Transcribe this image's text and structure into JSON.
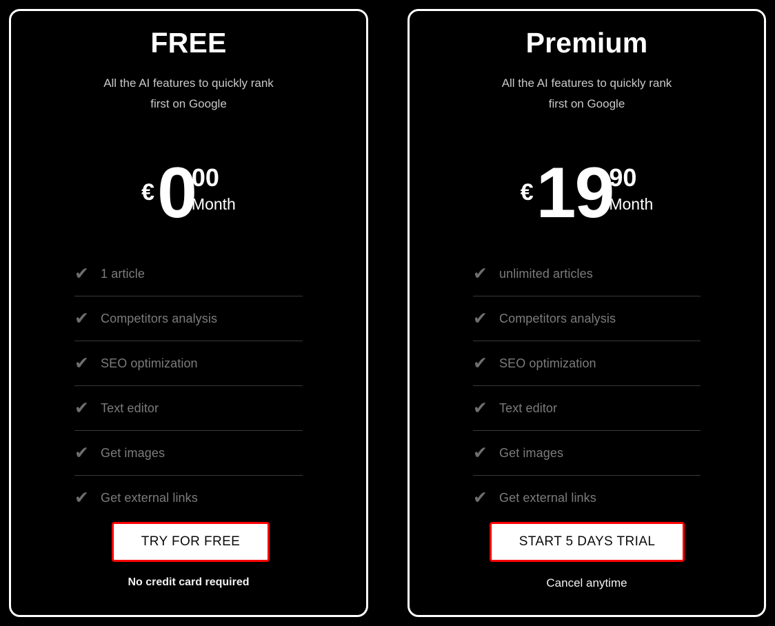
{
  "page": {
    "background_color": "#000000",
    "card_border_color": "#ffffff",
    "accent_color": "#ff0000",
    "muted_text_color": "#7c7c7c",
    "divider_color": "#3a3a3a"
  },
  "plans": [
    {
      "id": "free",
      "title": "FREE",
      "subtitle_line1": "All the AI features to quickly rank",
      "subtitle_line2": "first on Google",
      "price": {
        "currency_symbol": "€",
        "amount": "0",
        "cents": "00",
        "period": "Month"
      },
      "features": [
        {
          "check": "✔",
          "label": "1 article"
        },
        {
          "check": "✔",
          "label": "Competitors analysis"
        },
        {
          "check": "✔",
          "label": "SEO optimization"
        },
        {
          "check": "✔",
          "label": "Text editor"
        },
        {
          "check": "✔",
          "label": "Get images"
        },
        {
          "check": "✔",
          "label": "Get external links"
        }
      ],
      "cta_label": "TRY FOR FREE",
      "cta_note": "No credit card required"
    },
    {
      "id": "premium",
      "title": "Premium",
      "subtitle_line1": "All the AI features to quickly rank",
      "subtitle_line2": "first on Google",
      "price": {
        "currency_symbol": "€",
        "amount": "19",
        "cents": "90",
        "period": "Month"
      },
      "features": [
        {
          "check": "✔",
          "label": "unlimited articles"
        },
        {
          "check": "✔",
          "label": "Competitors analysis"
        },
        {
          "check": "✔",
          "label": "SEO optimization"
        },
        {
          "check": "✔",
          "label": "Text editor"
        },
        {
          "check": "✔",
          "label": "Get images"
        },
        {
          "check": "✔",
          "label": "Get external links"
        }
      ],
      "cta_label": "START 5 DAYS TRIAL",
      "cta_note": "Cancel anytime"
    }
  ]
}
